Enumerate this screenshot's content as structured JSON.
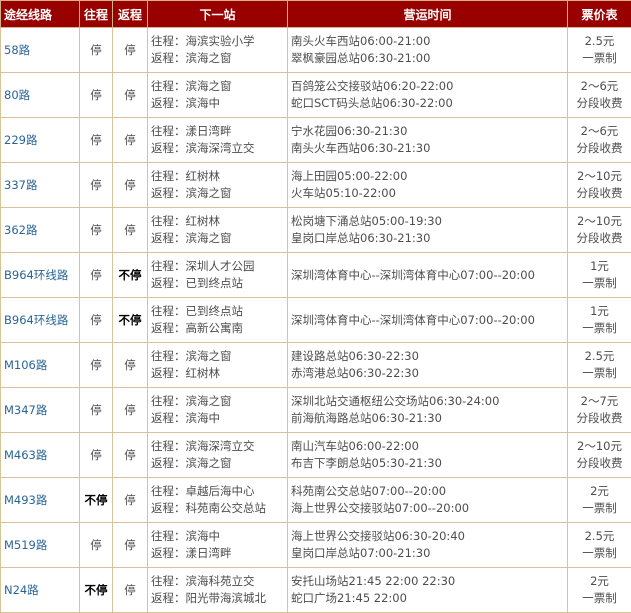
{
  "headers": {
    "route": "途经线路",
    "outbound": "往程",
    "inbound": "返程",
    "next_stop": "下一站",
    "hours": "营运时间",
    "fare": "票价表"
  },
  "rows": [
    {
      "route": "58路",
      "outbound": "停",
      "inbound": "停",
      "next_out": "往程：海滨实验小学",
      "next_in": "返程：滨海之窗",
      "hours_1": "南头火车西站06:00-21:00",
      "hours_2": "翠枫豪园总站06:30-21:00",
      "fare_1": "2.5元",
      "fare_2": "一票制"
    },
    {
      "route": "80路",
      "outbound": "停",
      "inbound": "停",
      "next_out": "往程：滨海之窗",
      "next_in": "返程：滨海中",
      "hours_1": "百鸽笼公交接驳站06:20-22:00",
      "hours_2": "蛇口SCT码头总站06:30-22:00",
      "fare_1": "2～6元",
      "fare_2": "分段收费"
    },
    {
      "route": "229路",
      "outbound": "停",
      "inbound": "停",
      "next_out": "往程：漾日湾畔",
      "next_in": "返程：滨海深湾立交",
      "hours_1": "宁水花园06:30-21:30",
      "hours_2": "南头火车西站06:30-21:30",
      "fare_1": "2～6元",
      "fare_2": "分段收费"
    },
    {
      "route": "337路",
      "outbound": "停",
      "inbound": "停",
      "next_out": "往程：红树林",
      "next_in": "返程：滨海之窗",
      "hours_1": "海上田园05:00-22:00",
      "hours_2": "火车站05:10-22:00",
      "fare_1": "2～10元",
      "fare_2": "分段收费"
    },
    {
      "route": "362路",
      "outbound": "停",
      "inbound": "停",
      "next_out": "往程：红树林",
      "next_in": "返程：滨海之窗",
      "hours_1": "松岗塘下涌总站05:00-19:30",
      "hours_2": "皇岗口岸总站06:30-21:30",
      "fare_1": "2～10元",
      "fare_2": "分段收费"
    },
    {
      "route": "B964环线路",
      "outbound": "停",
      "inbound": "不停",
      "next_out": "往程：深圳人才公园",
      "next_in": "返程：已到终点站",
      "hours_1": "深圳湾体育中心--深圳湾体育中心07:00--20:00",
      "hours_2": "",
      "fare_1": "1元",
      "fare_2": "一票制"
    },
    {
      "route": "B964环线路",
      "outbound": "停",
      "inbound": "不停",
      "next_out": "往程：已到终点站",
      "next_in": "返程：高新公寓南",
      "hours_1": "深圳湾体育中心--深圳湾体育中心07:00--20:00",
      "hours_2": "",
      "fare_1": "1元",
      "fare_2": "一票制"
    },
    {
      "route": "M106路",
      "outbound": "停",
      "inbound": "停",
      "next_out": "往程：滨海之窗",
      "next_in": "返程：红树林",
      "hours_1": "建设路总站06:30-22:30",
      "hours_2": "赤湾港总站06:30-22:30",
      "fare_1": "2.5元",
      "fare_2": "一票制"
    },
    {
      "route": "M347路",
      "outbound": "停",
      "inbound": "停",
      "next_out": "往程：滨海之窗",
      "next_in": "返程：滨海中",
      "hours_1": "深圳北站交通枢纽公交场站06:30-24:00",
      "hours_2": "前海航海路总站06:30-21:30",
      "fare_1": "2～7元",
      "fare_2": "分段收费"
    },
    {
      "route": "M463路",
      "outbound": "停",
      "inbound": "停",
      "next_out": "往程：滨海深湾立交",
      "next_in": "返程：滨海之窗",
      "hours_1": "南山汽车站06:00-22:00",
      "hours_2": "布吉下李朗总站05:30-21:30",
      "fare_1": "2～10元",
      "fare_2": "分段收费"
    },
    {
      "route": "M493路",
      "outbound": "不停",
      "inbound": "停",
      "next_out": "往程：卓越后海中心",
      "next_in": "返程：科苑南公交总站",
      "hours_1": "科苑南公交总站07:00--20:00",
      "hours_2": "海上世界公交接驳站07:00--20:00",
      "fare_1": "2元",
      "fare_2": "一票制"
    },
    {
      "route": "M519路",
      "outbound": "停",
      "inbound": "停",
      "next_out": "往程：滨海中",
      "next_in": "返程：漾日湾畔",
      "hours_1": "海上世界公交接驳站06:30-20:40",
      "hours_2": "皇岗口岸总站07:00-21:30",
      "fare_1": "2.5元",
      "fare_2": "一票制"
    },
    {
      "route": "N24路",
      "outbound": "不停",
      "inbound": "停",
      "next_out": "往程：滨海科苑立交",
      "next_in": "返程：阳光带海滨城北",
      "hours_1": "安托山场站21:45 22:00 22:30",
      "hours_2": "蛇口广场21:45 22:00",
      "fare_1": "2元",
      "fare_2": "一票制"
    }
  ]
}
